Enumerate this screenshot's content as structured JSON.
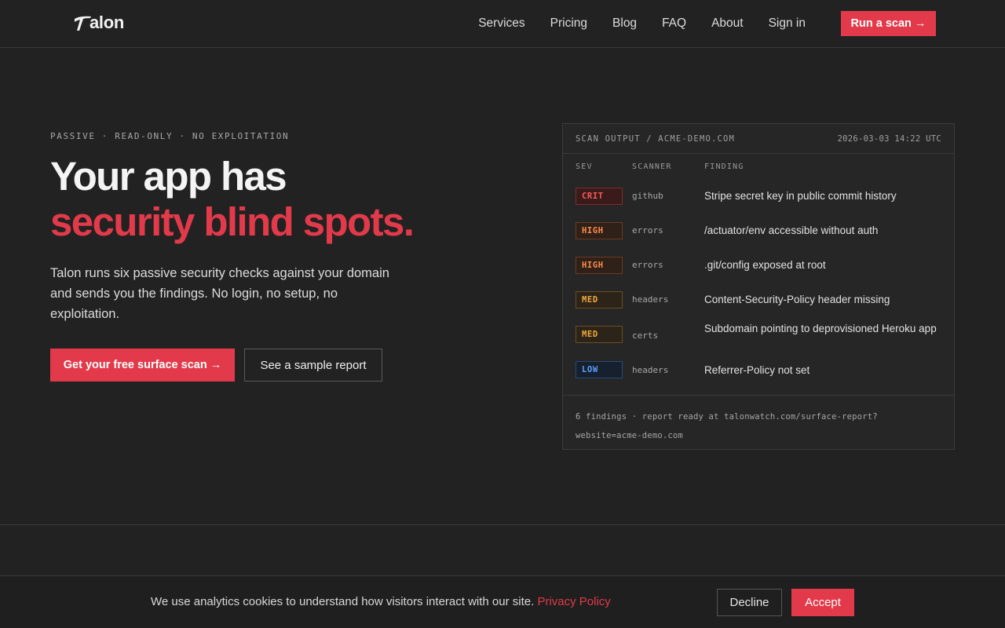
{
  "header": {
    "logo_text": "alon",
    "logo_mark": "T",
    "nav": [
      "Services",
      "Pricing",
      "Blog",
      "FAQ",
      "About",
      "Sign in"
    ],
    "cta": "Run a scan →"
  },
  "hero": {
    "eyebrow": "PASSIVE · READ-ONLY · NO EXPLOITATION",
    "title_line1": "Your app has",
    "title_line2": "security blind spots.",
    "lede": "Talon runs six passive security checks against your domain and sends you the findings. No login, no setup, no exploitation.",
    "primary_cta": "Get your free surface scan →",
    "secondary_cta": "See a sample report"
  },
  "scan": {
    "title": "SCAN OUTPUT / ACME-DEMO.COM",
    "timestamp": "2026-03-03 14:22 UTC",
    "columns": [
      "SEV",
      "SCANNER",
      "FINDING"
    ],
    "rows": [
      {
        "sev": "CRIT",
        "scanner": "github",
        "finding": "Stripe secret key in public commit history"
      },
      {
        "sev": "HIGH",
        "scanner": "errors",
        "finding": "/actuator/env accessible without auth"
      },
      {
        "sev": "HIGH",
        "scanner": "errors",
        "finding": ".git/config exposed at root"
      },
      {
        "sev": "MED",
        "scanner": "headers",
        "finding": "Content-Security-Policy header missing"
      },
      {
        "sev": "MED",
        "scanner": "certs",
        "finding": "Subdomain pointing to deprovisioned Heroku app"
      },
      {
        "sev": "LOW",
        "scanner": "headers",
        "finding": "Referrer-Policy not set"
      }
    ],
    "footer_line1": "6 findings · report ready at talonwatch.com/surface-report?",
    "footer_line2": "website=acme-demo.com"
  },
  "cookie": {
    "message": "We use analytics cookies to understand how visitors interact with our site.",
    "link": "Privacy Policy",
    "decline": "Decline",
    "accept": "Accept"
  },
  "colors": {
    "background": "#222222",
    "accent": "#e23a4a",
    "crit": "#ff5a5a",
    "high": "#ff8a4a",
    "med": "#f2a93b",
    "low": "#5aa0ff"
  }
}
